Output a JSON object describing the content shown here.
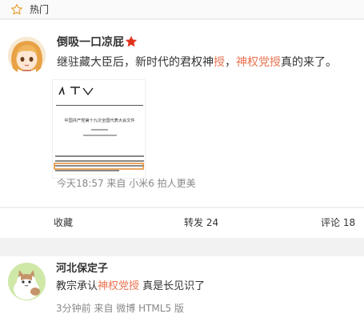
{
  "header": {
    "label": "热门",
    "icon": "star-outline-icon"
  },
  "post": {
    "author": "倒吸一口凉屁",
    "badge_icon": "red-star-badge-icon",
    "text_parts": [
      "继驻藏大臣后，新时代的君权神",
      "授",
      "，",
      "神权党授",
      "真的来了。"
    ],
    "image_caption": "中国共产党第十九次全国代表大会文件",
    "meta": "今天18:57 来自 小米6 拍人更美"
  },
  "actions": {
    "favorite": "收藏",
    "repost": "转发 24",
    "comment": "评论 18"
  },
  "comment": {
    "author": "河北保定子",
    "text_parts": [
      "教宗承认",
      "神权党授",
      " 真是长见识了"
    ],
    "meta": "3分钟前 来自 微博 HTML5 版"
  },
  "colors": {
    "accent": "#eb7350",
    "text": "#333333",
    "muted": "#888888"
  }
}
